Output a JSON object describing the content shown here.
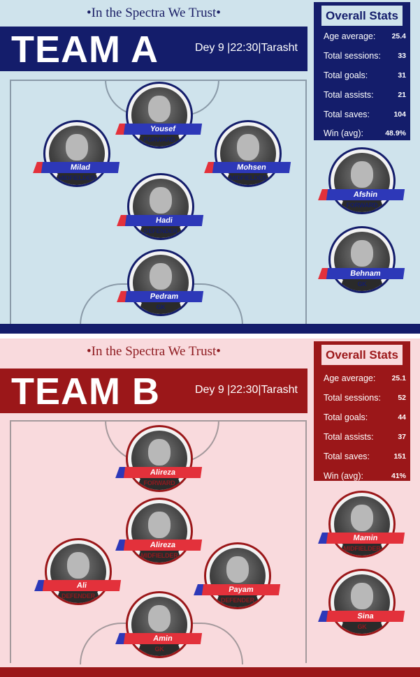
{
  "team_a": {
    "tagline": "•In the Spectra We Trust•",
    "team_name": "TEAM A",
    "match_info": "Dey 9 |22:30|Tarasht",
    "stats": {
      "title": "Overall Stats",
      "rows": [
        {
          "label": "Age average:",
          "value": "25.4"
        },
        {
          "label": "Total sessions:",
          "value": "33"
        },
        {
          "label": "Total goals:",
          "value": "31"
        },
        {
          "label": "Total assists:",
          "value": "21"
        },
        {
          "label": "Total saves:",
          "value": "104"
        },
        {
          "label": "Win (avg):",
          "value": "48.9%"
        }
      ]
    },
    "players": [
      {
        "name": "Yousef",
        "position": "FORWARD"
      },
      {
        "name": "Milad",
        "position": "MIDFIELDER"
      },
      {
        "name": "Mohsen",
        "position": "MIDFIELDER"
      },
      {
        "name": "Hadi",
        "position": "DEFENDER"
      },
      {
        "name": "Pedram",
        "position": "GK"
      }
    ],
    "substitutes": [
      {
        "name": "Afshin",
        "position": "FORWARD"
      },
      {
        "name": "Behnam",
        "position": "GK"
      }
    ]
  },
  "team_b": {
    "tagline": "•In the Spectra We Trust•",
    "team_name": "TEAM B",
    "match_info": "Dey 9 |22:30|Tarasht",
    "stats": {
      "title": "Overall Stats",
      "rows": [
        {
          "label": "Age average:",
          "value": "25.1"
        },
        {
          "label": "Total sessions:",
          "value": "52"
        },
        {
          "label": "Total goals:",
          "value": "44"
        },
        {
          "label": "Total assists:",
          "value": "37"
        },
        {
          "label": "Total saves:",
          "value": "151"
        },
        {
          "label": "Win (avg):",
          "value": "41%"
        }
      ]
    },
    "players": [
      {
        "name": "Alireza",
        "position": "FORWARD"
      },
      {
        "name": "Alireza",
        "position": "MIDFIELDER"
      },
      {
        "name": "Ali",
        "position": "DEFENDER"
      },
      {
        "name": "Payam",
        "position": "DEFENDER"
      },
      {
        "name": "Amin",
        "position": "GK"
      }
    ],
    "substitutes": [
      {
        "name": "Mamin",
        "position": "MIDFIELDER"
      },
      {
        "name": "Sina",
        "position": "GK"
      }
    ]
  },
  "colors": {
    "team_a_primary": "#141d6b",
    "team_a_background": "#cfe3ec",
    "team_b_primary": "#9b1719",
    "team_b_background": "#f9dadd",
    "accent_red": "#e3313b",
    "accent_blue": "#2d38b8"
  }
}
